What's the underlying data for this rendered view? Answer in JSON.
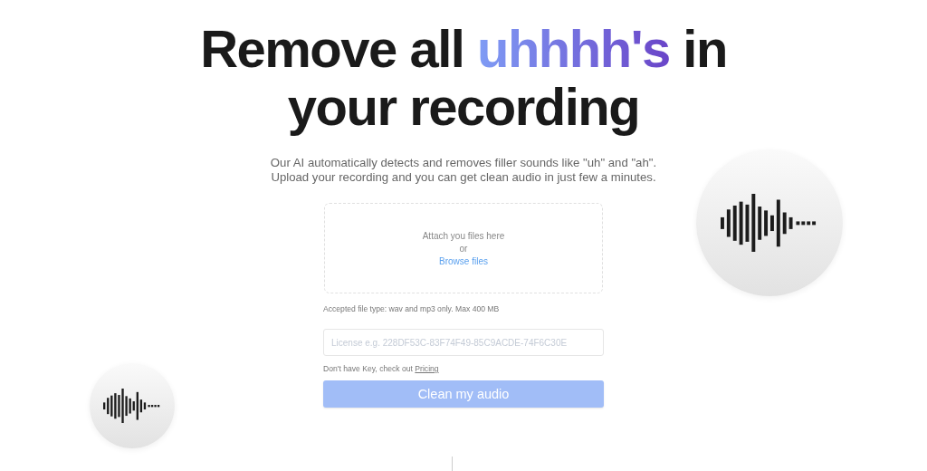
{
  "headline": {
    "before": "Remove all ",
    "highlight": "uhhhh's",
    "after": " in your recording"
  },
  "description": "Our AI automatically detects and removes filler sounds like \"uh\" and \"ah\". Upload your recording and you can get clean audio in just few a minutes.",
  "dropzone": {
    "prompt": "Attach you files here",
    "separator": "or",
    "browse_link": "Browse files"
  },
  "file_note": "Accepted file type: wav and mp3 only. Max 400 MB",
  "license_field": {
    "placeholder": "License e.g. 228DF53C-83F74F49-85C9ACDE-74F6C30E"
  },
  "key_note": {
    "text": "Don't have Key, check out ",
    "link": "Pricing"
  },
  "submit_button": "Clean my audio"
}
